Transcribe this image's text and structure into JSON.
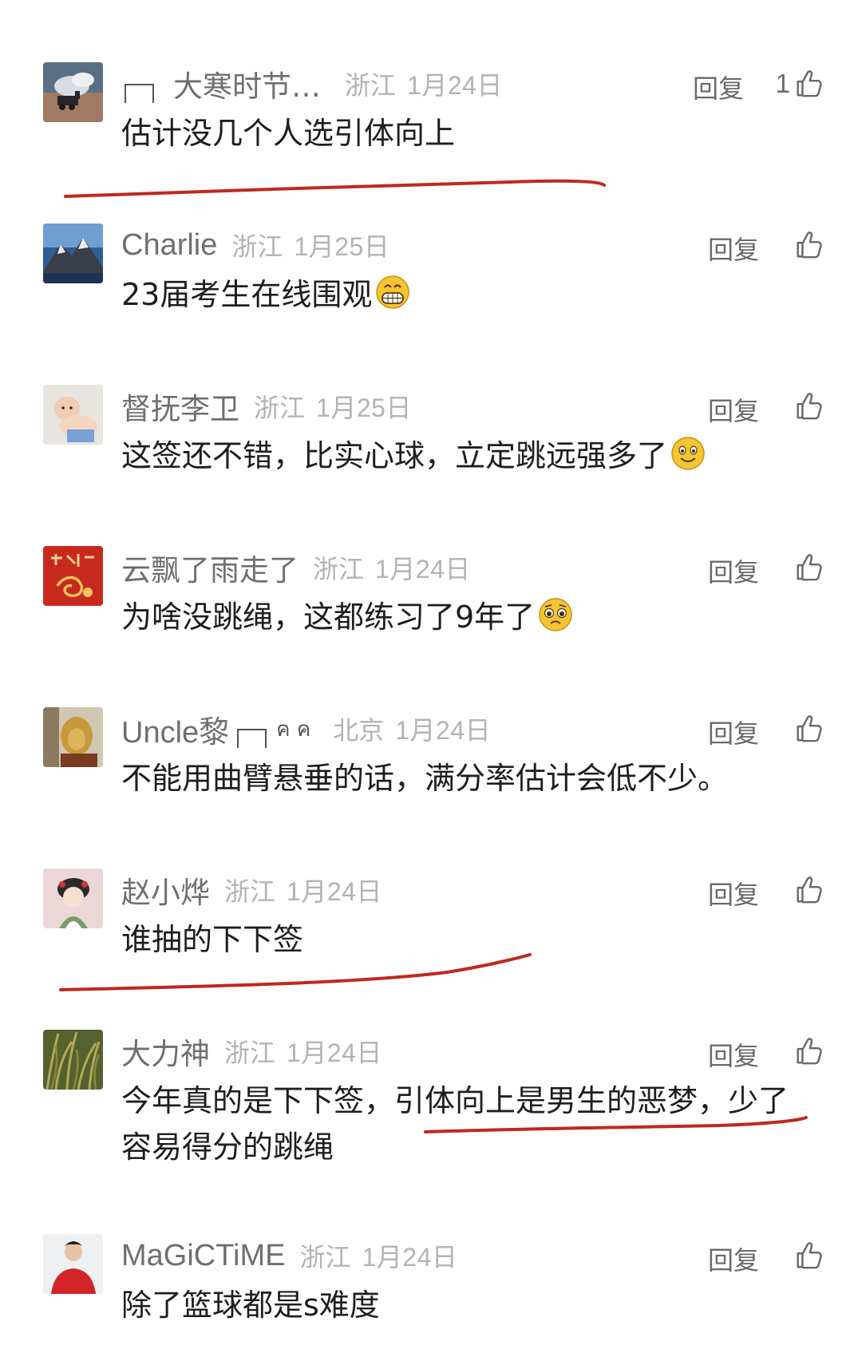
{
  "ui": {
    "reply_label": "回复",
    "colors": {
      "username": "#6f6f6f",
      "meta": "#b3b3b3",
      "text": "#1e1e1e",
      "annotation": "#c0281e"
    }
  },
  "comments": [
    {
      "username": "大寒时节…",
      "location": "浙江",
      "date": "1月24日",
      "like_count": "1",
      "text": "估计没几个人选引体向上",
      "avatar_icon": "steam-train-icon"
    },
    {
      "username": "Charlie",
      "location": "浙江",
      "date": "1月25日",
      "like_count": "",
      "text": "23届考生在线围观",
      "emoji": "grinning-face-icon",
      "avatar_icon": "mountain-icon"
    },
    {
      "username": "督抚李卫",
      "location": "浙江",
      "date": "1月25日",
      "like_count": "",
      "text": "这签还不错，比实心球，立定跳远强多了",
      "emoji": "smiling-face-icon",
      "avatar_icon": "baby-icon"
    },
    {
      "username": "云飘了雨走了",
      "location": "浙江",
      "date": "1月24日",
      "like_count": "",
      "text": "为啥没跳绳，这都练习了9年了",
      "emoji": "pleading-face-icon",
      "avatar_icon": "red-calligraphy-icon"
    },
    {
      "username": "Uncle黎",
      "badge_glyphs": "ค ค",
      "location": "北京",
      "date": "1月24日",
      "like_count": "",
      "text": "不能用曲臂悬垂的话，满分率估计会低不少。",
      "avatar_icon": "lion-icon"
    },
    {
      "username": "赵小烨",
      "location": "浙江",
      "date": "1月24日",
      "like_count": "",
      "text": "谁抽的下下签",
      "avatar_icon": "cartoon-girl-icon"
    },
    {
      "username": "大力神",
      "location": "浙江",
      "date": "1月24日",
      "like_count": "",
      "text": "今年真的是下下签，引体向上是男生的恶梦，少了容易得分的跳绳",
      "avatar_icon": "grass-icon"
    },
    {
      "username": "MaGiCTiME",
      "location": "浙江",
      "date": "1月24日",
      "like_count": "",
      "text": "除了篮球都是s难度",
      "avatar_icon": "man-red-shirt-icon"
    }
  ]
}
